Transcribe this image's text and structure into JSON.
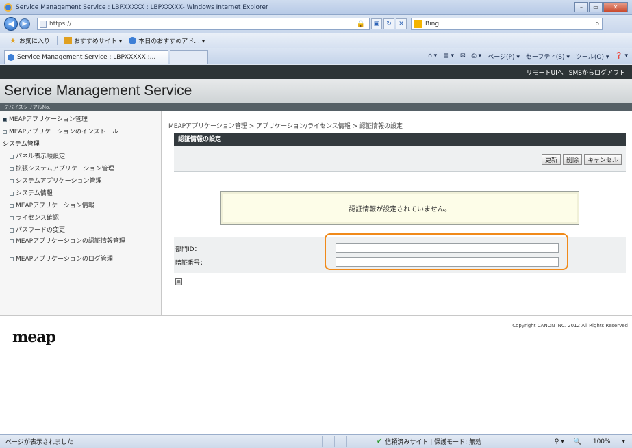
{
  "window": {
    "title": "Service Management Service : LBPXXXXX : LBPXXXXX- Windows Internet Explorer"
  },
  "address_bar": {
    "url": "https://",
    "search_engine": "Bing",
    "search_glyph": "ρ"
  },
  "favorites_bar": {
    "favorites_label": "お気に入り",
    "suggested_sites": "おすすめサイト ▾",
    "recommended": "本日のおすすめアド... ▾"
  },
  "tab": {
    "label": "Service Management Service : LBPXXXXX :..."
  },
  "command_bar": {
    "items": [
      "ページ(P) ▾",
      "セーフティ(S) ▾",
      "ツール(O) ▾"
    ]
  },
  "page": {
    "top_links": [
      "リモートUIへ",
      "SMSからログアウト"
    ],
    "app_title": "Service Management Service",
    "device_serial_label": "デバイスシリアルNo.:",
    "sidebar": {
      "meap_app_mgmt": "MEAPアプリケーション管理",
      "meap_app_install": "MEAPアプリケーションのインストール",
      "system_mgmt": "システム管理",
      "items": [
        "パネル表示順設定",
        "拡張システムアプリケーション管理",
        "システムアプリケーション管理",
        "システム情報",
        "MEAPアプリケーション情報",
        "ライセンス確認",
        "パスワードの変更",
        "MEAPアプリケーションの認証情報管理",
        "MEAPアプリケーションのログ管理"
      ]
    },
    "breadcrumb": "MEAPアプリケーション管理 > アプリケーション/ライセンス情報 > 認証情報の設定",
    "section_title": "認証情報の設定",
    "buttons": {
      "update": "更新",
      "delete": "削除",
      "cancel": "キャンセル"
    },
    "message": "認証情報が設定されていません。",
    "fields": {
      "user_id_label": "部門ID：",
      "pin_label": "暗証番号：",
      "user_id_value": "",
      "pin_value": ""
    },
    "help_glyph": "≡",
    "footer": {
      "logo": "meap",
      "copyright": "Copyright CANON INC. 2012 All Rights Reserved"
    }
  },
  "status_bar": {
    "left_text": "ページが表示されました",
    "zone_text": "信頼済みサイト | 保護モード: 無効",
    "zoom": "100%",
    "zoom_arrow": "▾"
  },
  "colors": {
    "accent_highlight": "#f08a1a",
    "top_strip": "#2d3436",
    "section_bar": "#333a3e"
  }
}
